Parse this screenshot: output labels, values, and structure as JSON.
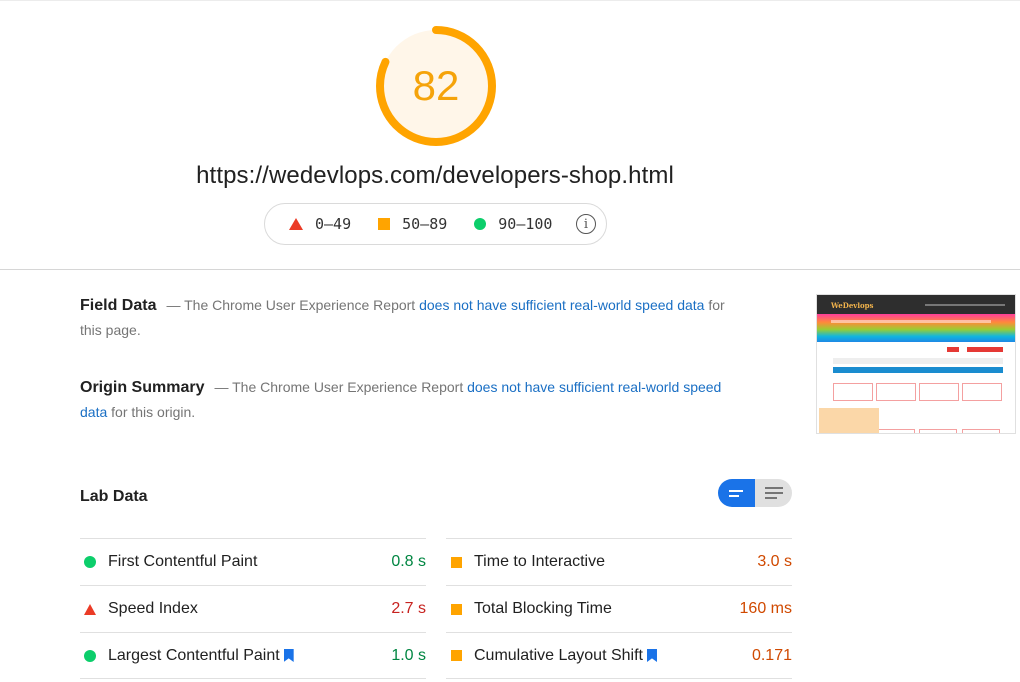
{
  "score": {
    "value": "82",
    "fraction": 0.82,
    "color": "#ffa400",
    "fill_color": "#fff6e9"
  },
  "url": "https://wedevlops.com/developers-shop.html",
  "legend": {
    "items": [
      {
        "shape": "triangle",
        "label": "0–49",
        "color": "#eb3b26"
      },
      {
        "shape": "square",
        "label": "50–89",
        "color": "#ffa400"
      },
      {
        "shape": "circle",
        "label": "90–100",
        "color": "#0cce6b"
      }
    ],
    "info_icon": "i"
  },
  "field_data": {
    "title": "Field Data",
    "prefix": "— The Chrome User Experience Report ",
    "link": "does not have sufficient real-world speed data",
    "suffix": " for this page."
  },
  "origin_summary": {
    "title": "Origin Summary",
    "prefix": "— The Chrome User Experience Report ",
    "link": "does not have sufficient real-world speed data",
    "suffix": " for this origin."
  },
  "thumbnail": {
    "logo": "WeDevlops"
  },
  "lab_data": {
    "title": "Lab Data",
    "toggle": {
      "selected": "summary-view",
      "options": [
        "summary-view",
        "detailed-view"
      ]
    },
    "left": [
      {
        "label": "First Contentful Paint",
        "value": "0.8 s",
        "rating": "good",
        "bookmark": false
      },
      {
        "label": "Speed Index",
        "value": "2.7 s",
        "rating": "bad",
        "bookmark": false
      },
      {
        "label": "Largest Contentful Paint",
        "value": "1.0 s",
        "rating": "good",
        "bookmark": true
      }
    ],
    "right": [
      {
        "label": "Time to Interactive",
        "value": "3.0 s",
        "rating": "avg",
        "bookmark": false
      },
      {
        "label": "Total Blocking Time",
        "value": "160 ms",
        "rating": "avg",
        "bookmark": false
      },
      {
        "label": "Cumulative Layout Shift",
        "value": "0.171",
        "rating": "avg",
        "bookmark": true
      }
    ]
  }
}
